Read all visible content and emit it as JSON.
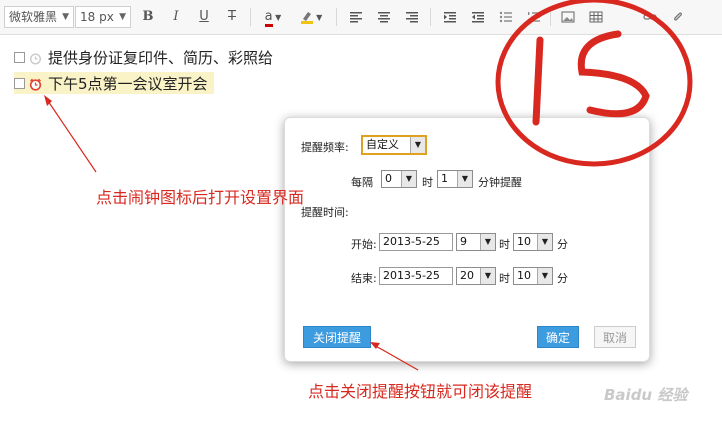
{
  "toolbar": {
    "font_family": "微软雅黑",
    "font_size": "18 px",
    "bold": "B",
    "italic": "I",
    "underline": "U",
    "strike": "T",
    "font_color_letter": "a",
    "icons": [
      "bold-icon",
      "italic-icon",
      "underline-icon",
      "strikethrough-icon",
      "font-color-icon",
      "highlight-icon",
      "align-left-icon",
      "align-center-icon",
      "align-right-icon",
      "indent-icon",
      "outdent-icon",
      "unordered-list-icon",
      "ordered-list-icon",
      "image-icon",
      "table-icon",
      "link-icon",
      "attachment-icon"
    ]
  },
  "tasks": [
    {
      "text": "提供身份证复印件、简历、彩照给"
    },
    {
      "text": "下午5点第一会议室开会"
    }
  ],
  "dialog": {
    "freq_label": "提醒频率:",
    "freq_value": "自定义",
    "every_label": "每隔",
    "hours_value": "0",
    "hours_unit": "时",
    "minutes_value": "1",
    "minutes_unit": "分钟提醒",
    "time_label": "提醒时间:",
    "start_label": "开始:",
    "start_date": "2013-5-25",
    "start_hour": "9",
    "start_min": "10",
    "end_label": "结束:",
    "end_date": "2013-5-25",
    "end_hour": "20",
    "end_min": "10",
    "hour_unit": "时",
    "min_unit": "分",
    "close_button": "关闭提醒",
    "ok_button": "确定",
    "cancel_button": "取消"
  },
  "annotations": {
    "clock_hint": "点击闹钟图标后打开设置界面",
    "close_hint": "点击关闭提醒按钮就可闭该提醒",
    "handwriting": "15",
    "color": "#d8281f"
  },
  "watermark": "Baidu 经验"
}
